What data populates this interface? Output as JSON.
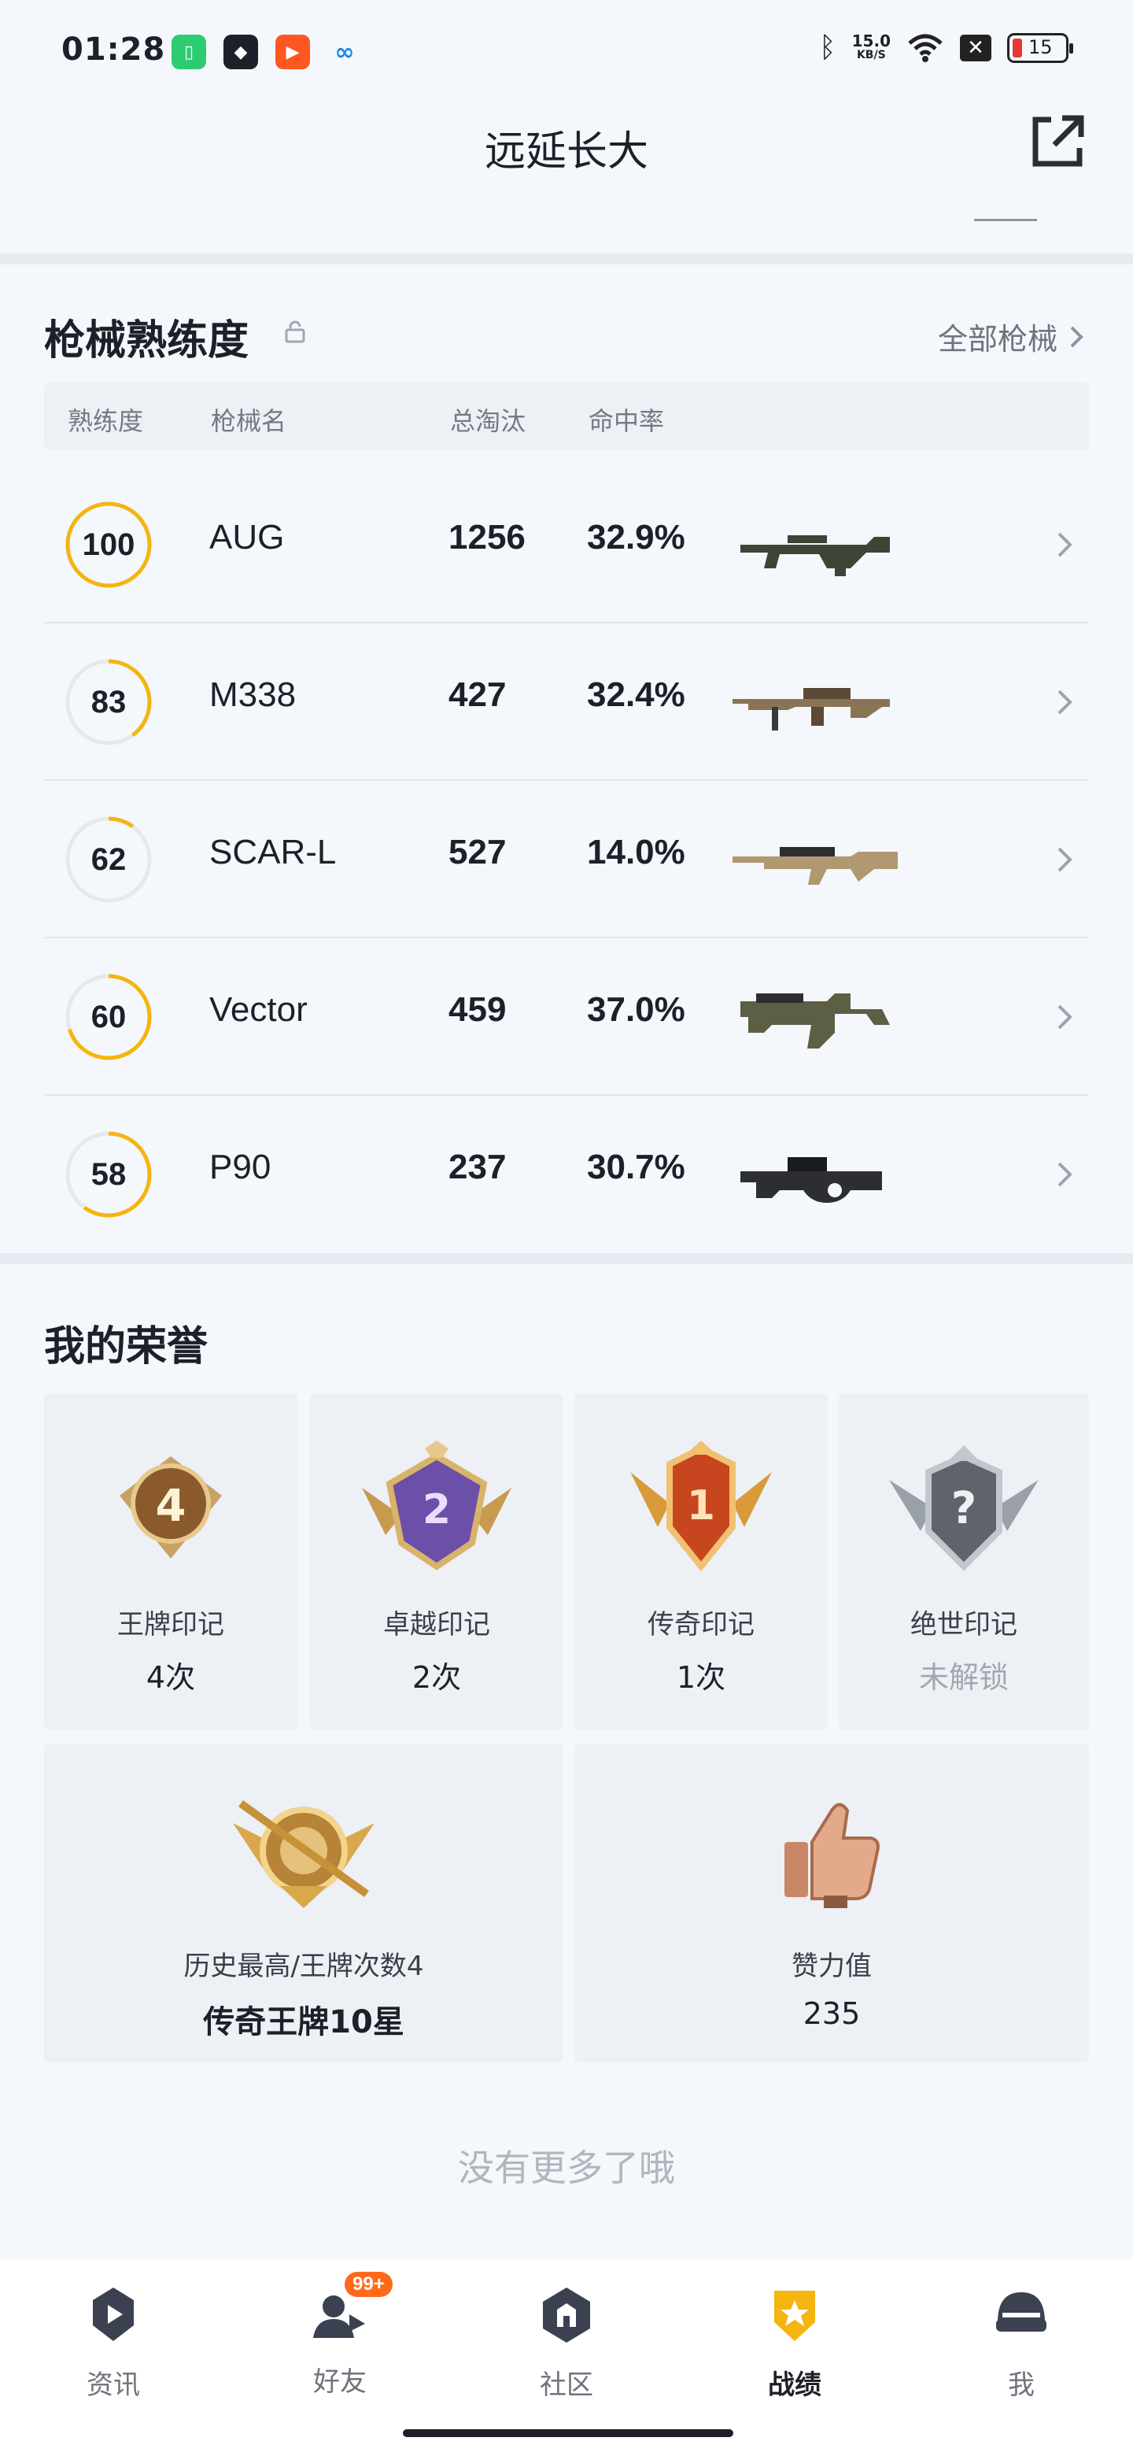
{
  "status_bar": {
    "time": "01:28",
    "network_speed": "15.0",
    "network_unit": "KB/S",
    "battery": "15",
    "icons": [
      "battery-saver-app-icon",
      "shield-app-icon",
      "video-app-icon",
      "cloud-app-icon",
      "bluetooth-icon",
      "wifi-icon",
      "close-box-icon"
    ]
  },
  "header": {
    "title": "远延长大",
    "share_icon": "share-external-icon"
  },
  "weapons": {
    "title": "枪械熟练度",
    "all_label": "全部枪械",
    "columns": [
      "熟练度",
      "枪械名",
      "总淘汰",
      "命中率"
    ],
    "rows": [
      {
        "level": "100",
        "level_pct": 100,
        "name": "AUG",
        "kills": "1256",
        "hit": "32.9%",
        "gun_icon": "aug-rifle-icon"
      },
      {
        "level": "83",
        "level_pct": 40,
        "name": "M338",
        "kills": "427",
        "hit": "32.4%",
        "gun_icon": "m338-lmg-icon"
      },
      {
        "level": "62",
        "level_pct": 10,
        "name": "SCAR-L",
        "kills": "527",
        "hit": "14.0%",
        "gun_icon": "scar-l-rifle-icon"
      },
      {
        "level": "60",
        "level_pct": 70,
        "name": "Vector",
        "kills": "459",
        "hit": "37.0%",
        "gun_icon": "vector-smg-icon"
      },
      {
        "level": "58",
        "level_pct": 60,
        "name": "P90",
        "kills": "237",
        "hit": "30.7%",
        "gun_icon": "p90-smg-icon"
      }
    ]
  },
  "honors": {
    "title": "我的荣誉",
    "cards": [
      {
        "label": "王牌印记",
        "value": "4次",
        "badge": "ace-mark-icon",
        "digit": "4"
      },
      {
        "label": "卓越印记",
        "value": "2次",
        "badge": "excellent-mark-icon",
        "digit": "2"
      },
      {
        "label": "传奇印记",
        "value": "1次",
        "badge": "legend-mark-icon",
        "digit": "1"
      },
      {
        "label": "绝世印记",
        "value": "未解锁",
        "badge": "peerless-mark-icon",
        "digit": "?"
      }
    ],
    "wide_cards": [
      {
        "label": "历史最高/王牌次数4",
        "value": "传奇王牌10星",
        "badge": "legend-ace-rank-icon"
      },
      {
        "label": "赞力值",
        "value": "235",
        "badge": "thumbs-up-icon"
      }
    ]
  },
  "footer_text": "没有更多了哦",
  "nav": {
    "items": [
      {
        "label": "资讯",
        "icon": "news-icon"
      },
      {
        "label": "好友",
        "icon": "friends-icon",
        "badge": "99+"
      },
      {
        "label": "社区",
        "icon": "community-icon"
      },
      {
        "label": "战绩",
        "icon": "record-icon",
        "active": true
      },
      {
        "label": "我",
        "icon": "me-helmet-icon"
      }
    ]
  },
  "colors": {
    "accent": "#f5b50f",
    "ring_track": "#e6e8ec",
    "text_primary": "#1d2028",
    "text_secondary": "#6e737c"
  }
}
